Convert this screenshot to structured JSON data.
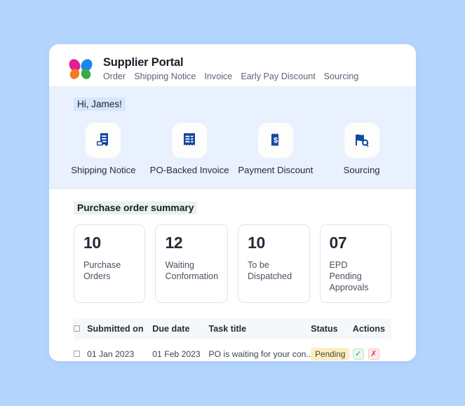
{
  "brand": {
    "title": "Supplier Portal",
    "logo_name": "butterfly-logo",
    "petal_colors": [
      "#e01f93",
      "#1a86f0",
      "#f47b20",
      "#3aab3f"
    ]
  },
  "nav": {
    "items": [
      {
        "label": "Order"
      },
      {
        "label": "Shipping Notice"
      },
      {
        "label": "Invoice"
      },
      {
        "label": "Early Pay Discount"
      },
      {
        "label": "Sourcing"
      }
    ]
  },
  "greeting": {
    "text": "Hi, James!",
    "highlight_color": "#d5e6fc"
  },
  "tiles": [
    {
      "label": "Shipping Notice",
      "icon": "shipping-notice-icon"
    },
    {
      "label": "PO-Backed Invoice",
      "icon": "invoice-receipt-icon"
    },
    {
      "label": "Payment Discount",
      "icon": "dollar-receipt-icon"
    },
    {
      "label": "Sourcing",
      "icon": "flag-search-icon"
    }
  ],
  "summary": {
    "title": "Purchase order summary",
    "highlight_color": "#e6f4e9",
    "cards": [
      {
        "value": "10",
        "label": "Purchase Orders"
      },
      {
        "value": "12",
        "label": "Waiting Conformation"
      },
      {
        "value": "10",
        "label": "To be Dispatched"
      },
      {
        "value": "07",
        "label": "EPD Pending Approvals"
      }
    ]
  },
  "table": {
    "headers": {
      "select": "",
      "submitted_on": "Submitted on",
      "due_date": "Due date",
      "task_title": "Task title",
      "status": "Status",
      "actions": "Actions"
    },
    "rows": [
      {
        "submitted_on": "01 Jan 2023",
        "due_date": "01 Feb 2023",
        "task_title": "PO is waiting for your con..",
        "status": "Pending",
        "status_color": "#fcefc2",
        "approve_icon": "check-icon",
        "reject_icon": "cross-icon"
      }
    ]
  }
}
